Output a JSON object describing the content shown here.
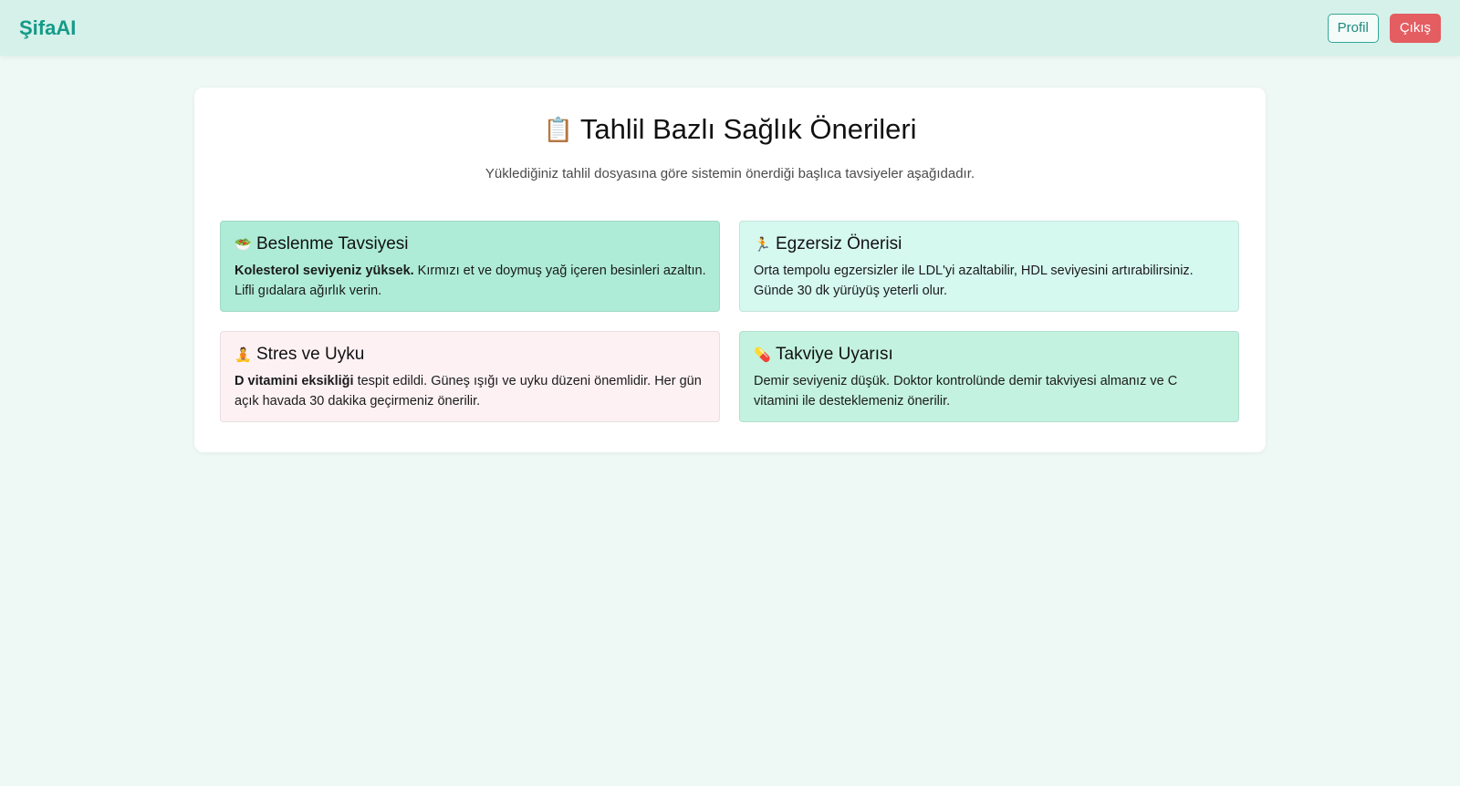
{
  "app": {
    "brand": "ŞifaAI"
  },
  "nav": {
    "profile_label": "Profil",
    "logout_label": "Çıkış"
  },
  "page": {
    "title_icon": "📋",
    "title": "Tahlil Bazlı Sağlık Önerileri",
    "subtitle": "Yüklediğiniz tahlil dosyasına göre sistemin önerdiği başlıca tavsiyeler aşağıdadır."
  },
  "tips": [
    {
      "icon": "🥗",
      "icon_name": "salad-icon",
      "title": "Beslenme Tavsiyesi",
      "bold": "Kolesterol seviyeniz yüksek.",
      "text": " Kırmızı et ve doymuş yağ içeren besinleri azaltın. Lifli gıdalara ağırlık verin.",
      "color": "#aeecd8"
    },
    {
      "icon": "🏃",
      "icon_name": "running-icon",
      "title": "Egzersiz Önerisi",
      "bold": "",
      "text": "Orta tempolu egzersizler ile LDL'yi azaltabilir, HDL seviyesini artırabilirsiniz. Günde 30 dk yürüyüş yeterli olur.",
      "color": "#d5f8ef"
    },
    {
      "icon": "🧘",
      "icon_name": "meditation-icon",
      "title": "Stres ve Uyku",
      "bold": "D vitamini eksikliği",
      "text": " tespit edildi. Güneş ışığı ve uyku düzeni önemlidir. Her gün açık havada 30 dakika geçirmeniz önerilir.",
      "color": "#fdf1f4"
    },
    {
      "icon": "💊",
      "icon_name": "pill-icon",
      "title": "Takviye Uyarısı",
      "bold": "",
      "text": "Demir seviyeniz düşük. Doktor kontrolünde demir takviyesi almanız ve C vitamini ile desteklemeniz önerilir.",
      "color": "#c3f2e0"
    }
  ]
}
